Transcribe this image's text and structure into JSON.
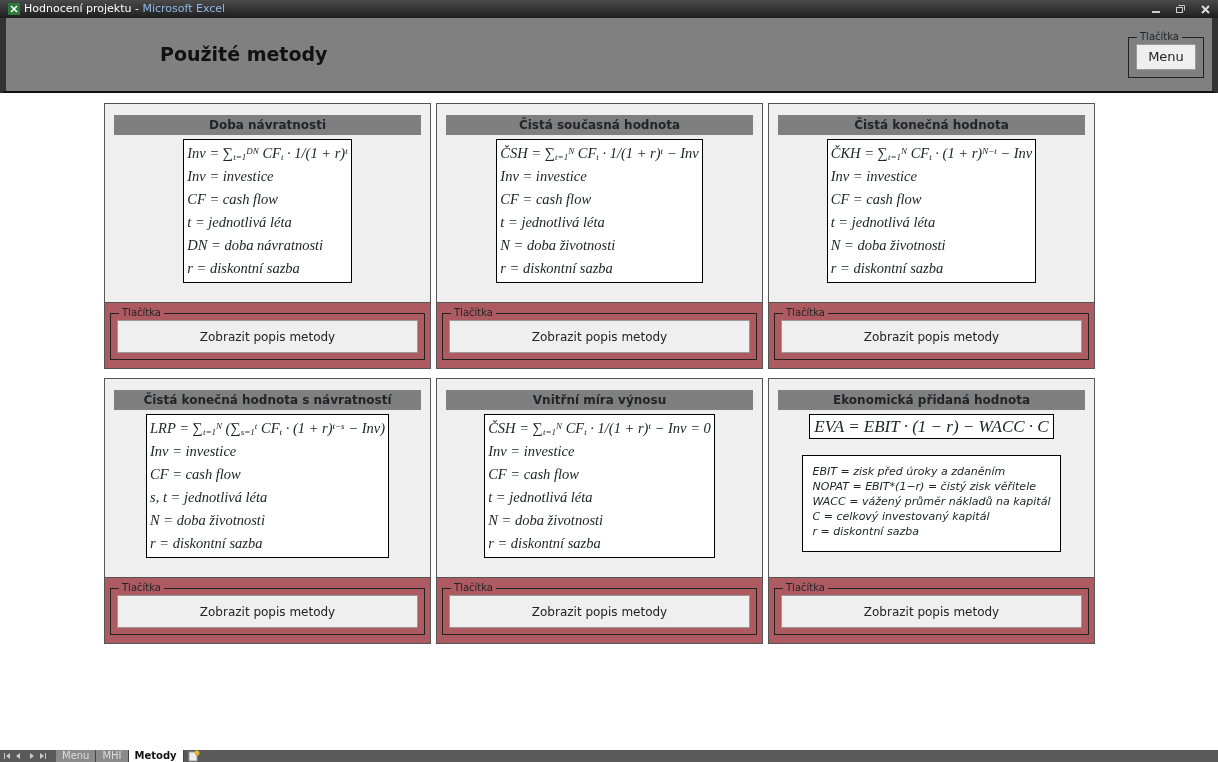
{
  "window": {
    "title": "Hodnocení projektu",
    "separator": "-",
    "app": "Microsoft Excel"
  },
  "header": {
    "title": "Použité metody",
    "group_label": "Tlačítka",
    "button": "Menu"
  },
  "panels": [
    {
      "title": "Doba návratnosti",
      "kind": "definitions",
      "formula": "Inv = ∑$_{t=1}$$^{DN}$ CF$_{t}$ · 1/(1 + r)$^{t}$",
      "lines": [
        "Inv = investice",
        "CF = cash flow",
        "t = jednotlivá léta",
        "DN = doba návratnosti",
        "r = diskontní sazba"
      ],
      "group_label": "Tlačítka",
      "button": "Zobrazit popis metody"
    },
    {
      "title": "Čistá současná hodnota",
      "kind": "definitions",
      "formula": "ČSH = ∑$_{t=1}$$^{N}$ CF$_{t}$ · 1/(1 + r)$^{t}$ − Inv",
      "lines": [
        "Inv = investice",
        "CF = cash flow",
        "t = jednotlivá léta",
        "N = doba životnosti",
        "r = diskontní sazba"
      ],
      "group_label": "Tlačítka",
      "button": "Zobrazit popis metody"
    },
    {
      "title": "Čistá konečná hodnota",
      "kind": "definitions",
      "formula": "ČKH = ∑$_{t=1}$$^{N}$ CF$_{t}$ · (1 + r)$^{N−t}$ − Inv",
      "lines": [
        "Inv = investice",
        "CF = cash flow",
        "t = jednotlivá léta",
        "N = doba životnosti",
        "r = diskontní sazba"
      ],
      "group_label": "Tlačítka",
      "button": "Zobrazit popis metody"
    },
    {
      "title": "Čistá konečná hodnota s návratností",
      "kind": "definitions",
      "formula": "LRP = ∑$_{t=1}$$^{N}$ (∑$_{s=1}$$^{t}$ CF$_{t}$ · (1 + r)$^{t−s}$ − Inv)",
      "lines": [
        "Inv = investice",
        "CF = cash flow",
        "s, t = jednotlivá léta",
        "N = doba životnosti",
        "r = diskontní sazba"
      ],
      "group_label": "Tlačítka",
      "button": "Zobrazit popis metody"
    },
    {
      "title": "Vnitřní míra výnosu",
      "kind": "definitions",
      "formula": "ČSH = ∑$_{t=1}$$^{N}$ CF$_{t}$ · 1/(1 + r)$^{t}$ − Inv = 0",
      "lines": [
        "Inv = investice",
        "CF = cash flow",
        "t = jednotlivá léta",
        "N = doba životnosti",
        "r = diskontní sazba"
      ],
      "group_label": "Tlačítka",
      "button": "Zobrazit popis metody"
    },
    {
      "title": "Ekonomická přidaná hodnota",
      "kind": "notes",
      "formula": "EVA = EBIT · (1 − r) − WACC · C",
      "lines": [
        "EBIT = zisk před úroky a zdaněním",
        "NOPAT = EBIT*(1−r) =  čistý zisk věřitele",
        "WACC = vážený průměr nákladů na kapitál",
        "C = celkový investovaný kapitál",
        "r = diskontní sazba"
      ],
      "group_label": "Tlačítka",
      "button": "Zobrazit popis metody"
    }
  ],
  "sheet_tabs": [
    {
      "label": "Menu",
      "selected": false
    },
    {
      "label": "MHI",
      "selected": false
    },
    {
      "label": "Metody",
      "selected": true
    }
  ]
}
